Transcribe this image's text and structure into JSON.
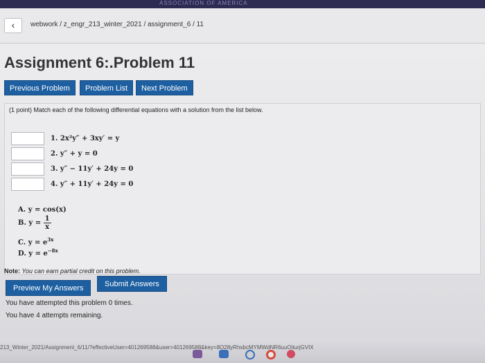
{
  "breadcrumb": {
    "path": "webwork / z_engr_213_winter_2021 / assignment_6 / 11"
  },
  "title": "Assignment 6:.Problem 11",
  "nav": {
    "previous": "Previous Problem",
    "list": "Problem List",
    "next": "Next Problem"
  },
  "problem": {
    "intro": "(1 point) Match each of the following differential equations with a solution from the list below.",
    "equations": [
      {
        "label": "1. 2x²y″ + 3xy′ = y",
        "value": ""
      },
      {
        "label": "2. y″ + y = 0",
        "value": ""
      },
      {
        "label": "3. y″ − 11y′ + 24y = 0",
        "value": ""
      },
      {
        "label": "4. y″ + 11y′ + 24y = 0",
        "value": ""
      }
    ],
    "solutions": {
      "a": "A. y = cos(x)",
      "b_prefix": "B. y =",
      "b_num": "1",
      "b_den": "x",
      "c_prefix": "C. y = e",
      "c_exp": "3x",
      "d_prefix": "D. y = e",
      "d_exp": "−8x"
    }
  },
  "note": {
    "label": "Note:",
    "text": "You can earn partial credit on this problem."
  },
  "actions": {
    "preview": "Preview My Answers",
    "submit": "Submit Answers"
  },
  "attempts": {
    "line1": "You have attempted this problem 0 times.",
    "line2": "You have 4 attempts remaining."
  },
  "status_url": "213_Winter_2021/Assignment_6/11/?effectiveUser=401269588&user=401269588&key=8O28yRhsbcMYMWdNR6uuOiturjGVIX",
  "top_band_text": "ASSOCIATION OF AMERICA",
  "colors": {
    "button_blue": "#1d5fa1",
    "page_bg": "#eeeef0"
  }
}
